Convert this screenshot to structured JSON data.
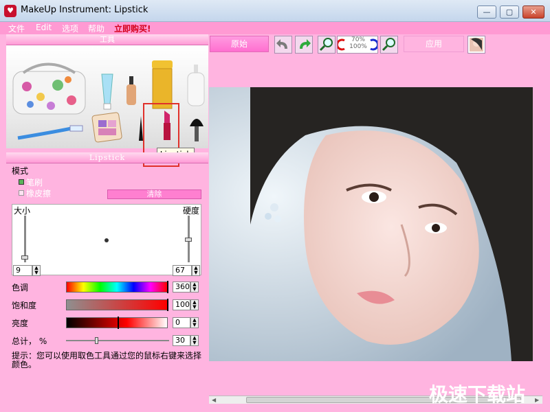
{
  "window": {
    "title": "MakeUp Instrument: Lipstick",
    "minimize": "—",
    "maximize": "▢",
    "close": "✕"
  },
  "menu": {
    "items": [
      "文件",
      "Edit",
      "选项",
      "帮助"
    ],
    "buy": "立即购买!"
  },
  "tools_panel": {
    "header": "工具",
    "subheader": "Lipstick",
    "tooltip": "Lipstick"
  },
  "settings_panel": {
    "header": "Lipstick",
    "mode_label": "模式",
    "brush_label": "笔刷",
    "eraser_label": "橡皮擦",
    "clear_label": "清除",
    "size_label": "大小",
    "hardness_label": "硬度",
    "size_value": "9",
    "hardness_value": "67",
    "hue_label": "色调",
    "hue_value": "360",
    "saturation_label": "饱和度",
    "saturation_value": "100",
    "brightness_label": "亮度",
    "brightness_value": "0",
    "total_label": "总计， %",
    "total_value": "30",
    "hint": "提示：您可以使用取色工具通过您的鼠标右键来选择颜色。"
  },
  "toolbar": {
    "original_label": "原始",
    "zoom_text": "70%\n100%",
    "apply_label": "应用"
  },
  "watermark": "极速下载站",
  "colors": {
    "panel_pink": "#ffb4e0",
    "menu_pink": "#ff9ad3",
    "accent_red": "#e0302a"
  }
}
